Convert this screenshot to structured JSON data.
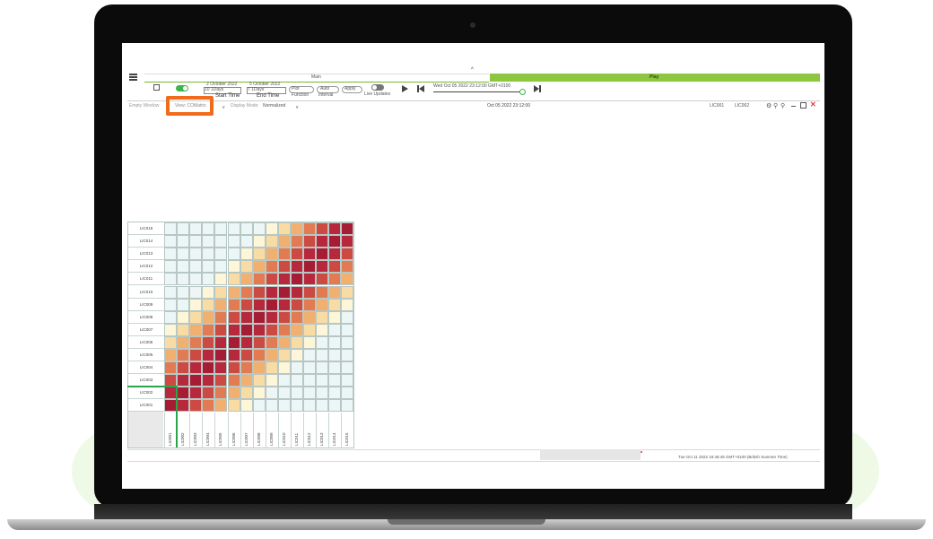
{
  "app": {
    "menu_icon": "hamburger-icon",
    "collapse_icon": "chevron-up-icon"
  },
  "tabs": {
    "main": "Main",
    "play": "Play"
  },
  "controls": {
    "start_date": "2 October 2022",
    "start_sel": "10 1Days",
    "start_label": "Start Time",
    "end_date": "5 October 2022",
    "end_sel": "7 1Days",
    "end_label": "End Time",
    "function_value": "Plot",
    "function_label": "Function",
    "interval_value": "Auto",
    "interval_label": "Interval",
    "apply_label": "Apply",
    "live_label": "Live Updates",
    "timeline_text": "Wed Oct 05 2022 23:12:00 GMT+0100"
  },
  "window": {
    "empty_label": "Empty Window",
    "view_label": "View: COMatrix",
    "display_mode_label": "Display Mode:",
    "display_mode_value": "Normalized",
    "timestamp": "Oct 05 2022 23:12:00",
    "right_sel1": "LIC001",
    "right_sel2": "LIC002"
  },
  "footer": {
    "timestamp": "Tue Oct 11 2022 16:48:45 GMT+0100 (British Summer Time)"
  },
  "chart_data": {
    "type": "heatmap",
    "x_labels": [
      "LIC001",
      "LIC002",
      "LIC003",
      "LIC004",
      "LIC005",
      "LIC006",
      "LIC007",
      "LIC008",
      "LIC009",
      "LIC010",
      "LIC011",
      "LIC012",
      "LIC013",
      "LIC014",
      "LIC015"
    ],
    "y_labels": [
      "LIC015",
      "LIC014",
      "LIC013",
      "LIC012",
      "LIC011",
      "LIC010",
      "LIC009",
      "LIC008",
      "LIC007",
      "LIC006",
      "LIC005",
      "LIC004",
      "LIC003",
      "LIC002",
      "LIC001"
    ],
    "colors": [
      "#ecf6f6",
      "#fdf6d8",
      "#f9dca4",
      "#f1b070",
      "#e27a52",
      "#cc4a42",
      "#b7283c",
      "#a51c34"
    ],
    "highlight": "#2aa64a"
  },
  "colors": {
    "accent": "#8dc63f",
    "tab_line": "#76b82a",
    "toggle": "#3cb54a",
    "highlight": "#f26a1b",
    "close": "#e53935"
  }
}
